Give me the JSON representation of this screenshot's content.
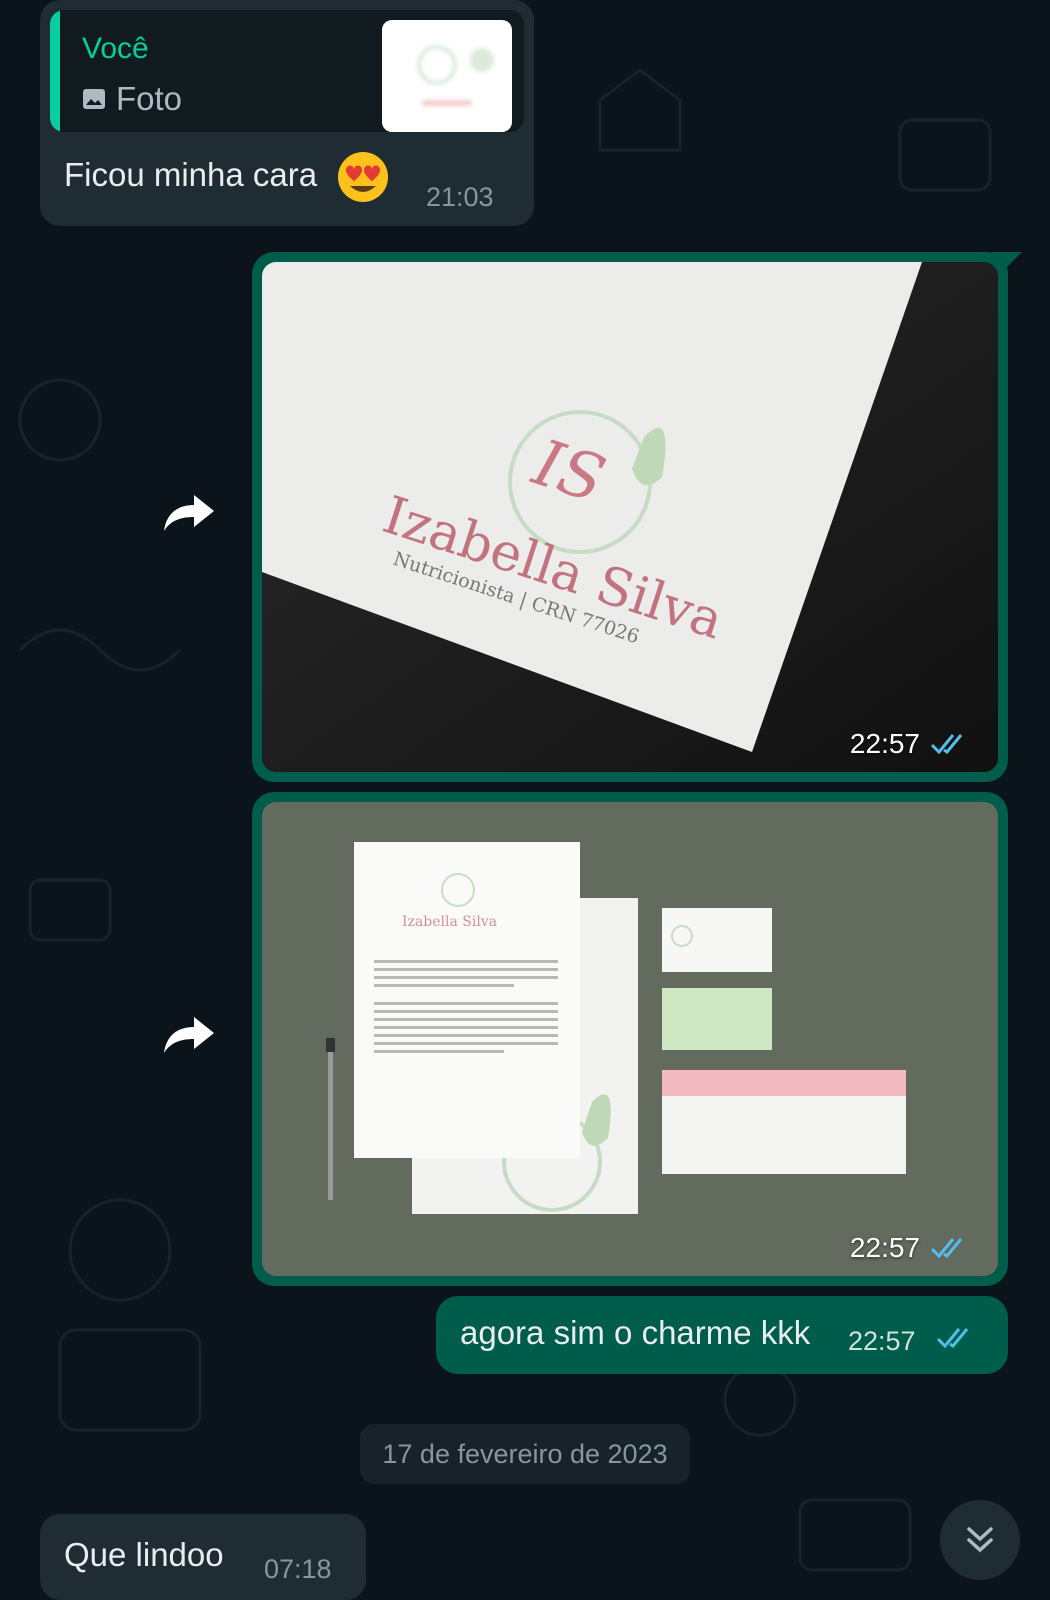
{
  "messages": {
    "incoming_1": {
      "quote_author": "Você",
      "quote_type": "Foto",
      "text": "Ficou minha cara",
      "time": "21:03"
    },
    "image_1": {
      "logo_initials": "IS",
      "logo_name": "Izabella Silva",
      "logo_subtitle": "Nutricionista | CRN 77026",
      "time": "22:57"
    },
    "image_2": {
      "logo_name": "Izabella Silva",
      "time": "22:57"
    },
    "outgoing_text": {
      "text": "agora sim o charme kkk",
      "time": "22:57"
    },
    "date_divider": "17 de fevereiro de 2023",
    "incoming_2": {
      "text": "Que lindoo",
      "time": "07:18"
    }
  },
  "icons": {
    "read_receipt": "double-check-icon",
    "forward": "forward-icon",
    "scroll_down": "chevron-double-down-icon",
    "photo": "photo-icon",
    "emoji": "heart-eyes-emoji"
  },
  "colors": {
    "background": "#0b141a",
    "incoming_bubble": "#1f2c33",
    "outgoing_bubble": "#005c4b",
    "accent": "#06cf9c",
    "read_tick": "#53bdeb"
  }
}
